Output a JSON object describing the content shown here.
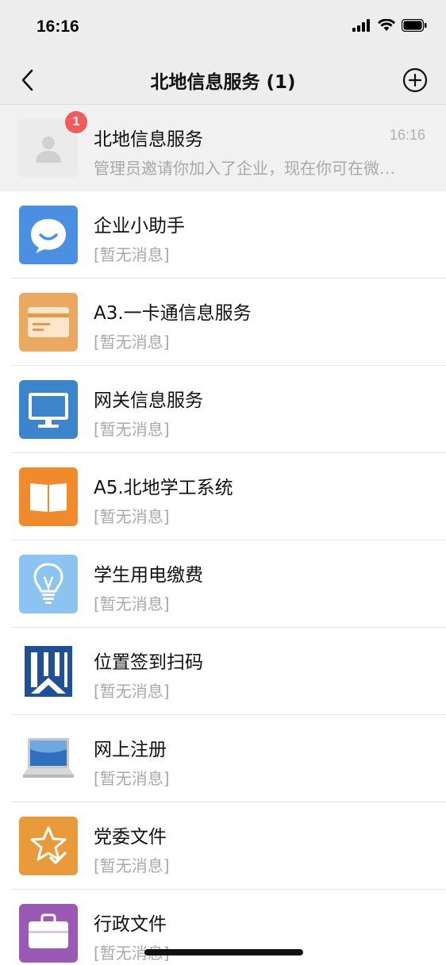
{
  "status_bar": {
    "time": "16:16"
  },
  "nav": {
    "title": "北地信息服务 (1)"
  },
  "pinned": {
    "name": "北地信息服务",
    "preview": "管理员邀请你加入了企业，现在你可在微…",
    "time": "16:16",
    "badge": "1",
    "icon": "person-placeholder-icon"
  },
  "apps": [
    {
      "name": "企业小助手",
      "sub": "[暂无消息]",
      "icon": "chat-bubble-icon",
      "color": "#4a8fe2"
    },
    {
      "name": "A3.一卡通信息服务",
      "sub": "[暂无消息]",
      "icon": "card-icon",
      "color": "#eaa860"
    },
    {
      "name": "网关信息服务",
      "sub": "[暂无消息]",
      "icon": "monitor-icon",
      "color": "#3c84cc"
    },
    {
      "name": "A5.北地学工系统",
      "sub": "[暂无消息]",
      "icon": "book-icon",
      "color": "#f08a2a"
    },
    {
      "name": "学生用电缴费",
      "sub": "[暂无消息]",
      "icon": "lightbulb-icon",
      "color": "#8cc3f0"
    },
    {
      "name": "位置签到扫码",
      "sub": "[暂无消息]",
      "icon": "logo-icon",
      "color": "#1f4f94"
    },
    {
      "name": "网上注册",
      "sub": "[暂无消息]",
      "icon": "laptop-icon",
      "color": "#2f6fbf"
    },
    {
      "name": "党委文件",
      "sub": "[暂无消息]",
      "icon": "star-check-icon",
      "color": "#e99a3a"
    },
    {
      "name": "行政文件",
      "sub": "[暂无消息]",
      "icon": "briefcase-icon",
      "color": "#9b59b6"
    }
  ]
}
